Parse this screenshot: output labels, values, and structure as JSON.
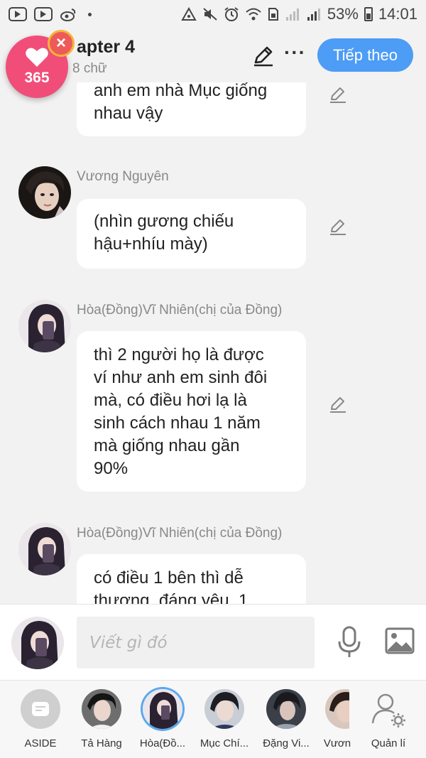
{
  "statusbar": {
    "battery": "53%",
    "time": "14:01"
  },
  "header": {
    "title": "apter 4",
    "word_count": "8 chữ",
    "next_label": "Tiếp theo"
  },
  "badge": {
    "count": "365"
  },
  "messages": [
    {
      "sender": "",
      "lines": [
        "anh em nhà Mục giống",
        "nhau vậy"
      ],
      "avatar": "none"
    },
    {
      "sender": "Vương Nguyên",
      "lines": [
        "(nhìn gương chiếu",
        "hậu+nhíu mày)"
      ],
      "avatar": "male"
    },
    {
      "sender": "Hòa(Đồng)Vĩ Nhiên(chị của Đồng)",
      "lines": [
        "thì 2 người họ là được",
        "ví như anh em sinh đôi",
        "mà, có điều hơi lạ là",
        "sinh cách nhau 1 năm",
        "mà giống nhau gần",
        "90%"
      ],
      "avatar": "female"
    },
    {
      "sender": "Hòa(Đồng)Vĩ Nhiên(chị của Đồng)",
      "lines": [
        "có điều 1 bên thì dễ",
        "thương, đáng yêu, 1"
      ],
      "avatar": "female"
    }
  ],
  "composer": {
    "placeholder": "Viết gì đó"
  },
  "characters": [
    {
      "label": "ASIDE"
    },
    {
      "label": "Tả Hàng"
    },
    {
      "label": "Hòa(Đồ..."
    },
    {
      "label": "Mục Chí..."
    },
    {
      "label": "Đặng Vi..."
    },
    {
      "label": "Vươn"
    },
    {
      "label": "Quản lí"
    }
  ],
  "colors": {
    "accent": "#4d9cf5",
    "badge": "#f04e78",
    "bubble": "#ffffff",
    "background": "#f2f2f2"
  }
}
